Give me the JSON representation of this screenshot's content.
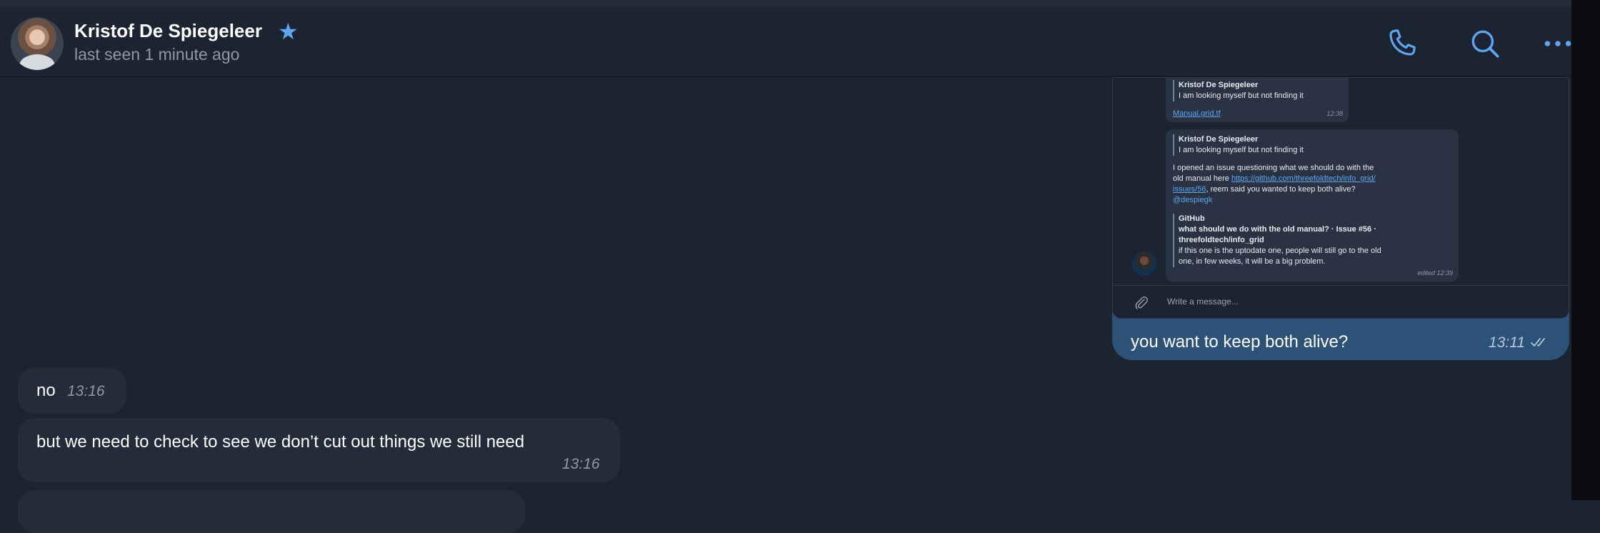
{
  "header": {
    "contact_name": "Kristof De Spiegeleer",
    "status": "last seen 1 minute ago"
  },
  "outgoing": {
    "text": "you want to keep both alive?",
    "time": "13:11",
    "screenshot": {
      "bubble1": {
        "reply_author": "Kristof De Spiegeleer",
        "reply_text": "I am looking myself but not finding it",
        "link": "Manual.grid.tf",
        "time": "12:38"
      },
      "bubble2": {
        "reply_author": "Kristof De Spiegeleer",
        "reply_text": "I am looking myself but not finding it",
        "body_1": "I opened an issue questioning what we should do with the",
        "body_2": "old manual here",
        "link_1": "https://github.com/threefoldtech/info_grid/",
        "link_2": "issues/56",
        "body_3": ", reem said you wanted to keep both alive?",
        "mention": "@despiegk",
        "preview_site": "GitHub",
        "preview_title_1": "what should we do with the old manual? · Issue #56 ·",
        "preview_title_2": "threefoldtech/info_grid",
        "preview_desc_1": "if this one is the uptodate one, people will still go to the old",
        "preview_desc_2": "one, in few weeks, it will be a big problem.",
        "time": "edited 12:39"
      },
      "input_placeholder": "Write a message..."
    }
  },
  "incoming": [
    {
      "text": "no",
      "time": "13:16"
    },
    {
      "text": "but we need to check to see we don’t cut out things we still need",
      "time": "13:16"
    }
  ],
  "colors": {
    "background": "#1c2331",
    "incoming_bubble": "#242c3a",
    "outgoing_bubble": "#2d5278",
    "accent": "#5ea5f3"
  }
}
